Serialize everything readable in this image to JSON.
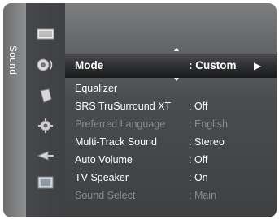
{
  "side_tab": {
    "label": "Sound"
  },
  "icons": [
    {
      "name": "picture-icon"
    },
    {
      "name": "sound-icon"
    },
    {
      "name": "channel-icon"
    },
    {
      "name": "setup-icon"
    },
    {
      "name": "input-icon"
    },
    {
      "name": "application-icon"
    }
  ],
  "menu": {
    "selected": {
      "label": "Mode",
      "value": ": Custom"
    },
    "items": [
      {
        "label": "Equalizer",
        "value": ""
      },
      {
        "label": "SRS TruSurround XT",
        "value": ": Off"
      },
      {
        "label": "Preferred Language",
        "value": ": English",
        "disabled": true
      },
      {
        "label": "Multi-Track Sound",
        "value": ": Stereo"
      },
      {
        "label": "Auto Volume",
        "value": ": Off"
      },
      {
        "label": "TV Speaker",
        "value": ": On"
      },
      {
        "label": "Sound Select",
        "value": ": Main",
        "disabled": true
      }
    ]
  }
}
